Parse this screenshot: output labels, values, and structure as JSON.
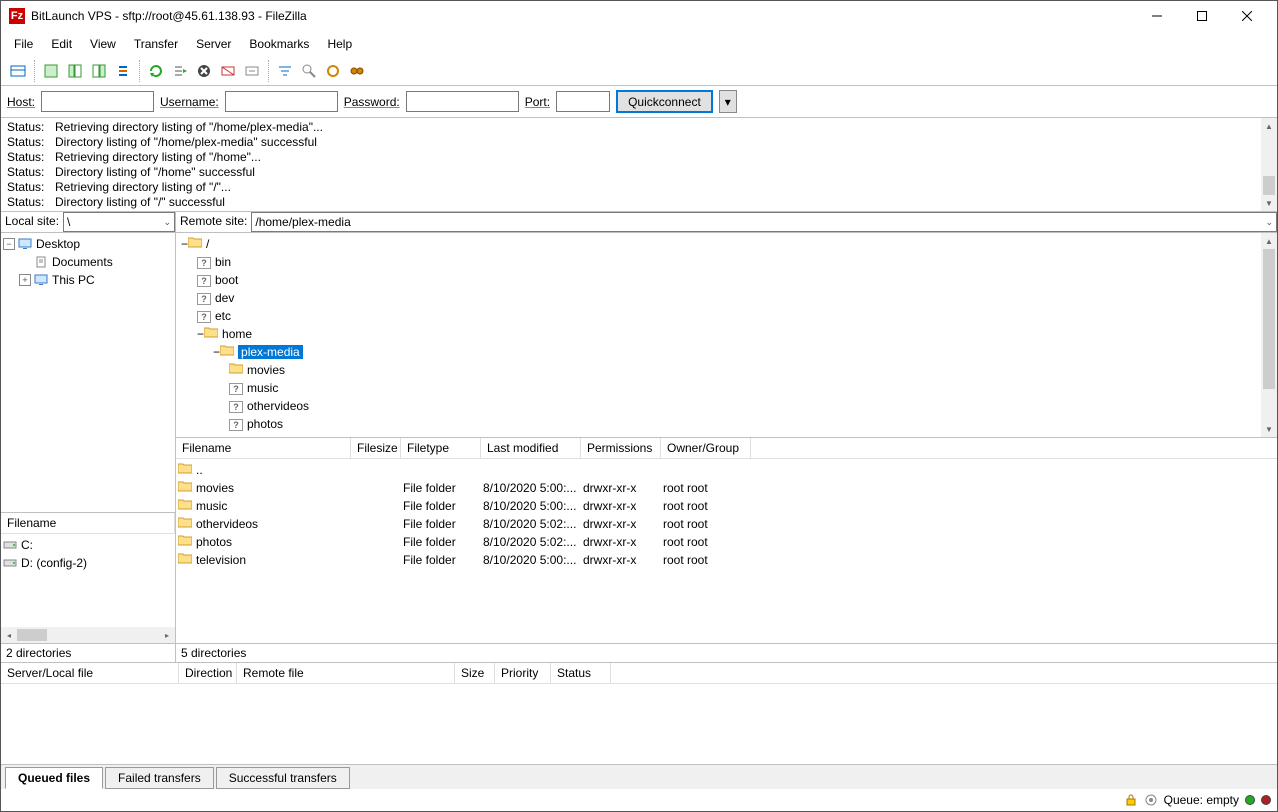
{
  "window": {
    "title": "BitLaunch VPS - sftp://root@45.61.138.93 - FileZilla"
  },
  "menu": [
    "File",
    "Edit",
    "View",
    "Transfer",
    "Server",
    "Bookmarks",
    "Help"
  ],
  "quickconnect": {
    "host_label": "Host:",
    "username_label": "Username:",
    "password_label": "Password:",
    "port_label": "Port:",
    "button": "Quickconnect",
    "host": "",
    "username": "",
    "password": "",
    "port": ""
  },
  "status_log": [
    {
      "label": "Status:",
      "msg": "Retrieving directory listing of \"/home/plex-media\"..."
    },
    {
      "label": "Status:",
      "msg": "Directory listing of \"/home/plex-media\" successful"
    },
    {
      "label": "Status:",
      "msg": "Retrieving directory listing of \"/home\"..."
    },
    {
      "label": "Status:",
      "msg": "Directory listing of \"/home\" successful"
    },
    {
      "label": "Status:",
      "msg": "Retrieving directory listing of \"/\"..."
    },
    {
      "label": "Status:",
      "msg": "Directory listing of \"/\" successful"
    }
  ],
  "local": {
    "site_label": "Local site:",
    "path": "\\",
    "tree": [
      {
        "name": "Desktop",
        "icon": "desktop",
        "exp": "-",
        "level": 0
      },
      {
        "name": "Documents",
        "icon": "doc",
        "exp": "",
        "level": 1
      },
      {
        "name": "This PC",
        "icon": "pc",
        "exp": "+",
        "level": 1
      }
    ],
    "list_header": "Filename",
    "drives": [
      {
        "name": "C:"
      },
      {
        "name": "D: (config-2)"
      }
    ],
    "status": "2 directories"
  },
  "remote": {
    "site_label": "Remote site:",
    "path": "/home/plex-media",
    "tree": [
      {
        "name": "/",
        "icon": "folder",
        "exp": "-",
        "level": 0
      },
      {
        "name": "bin",
        "icon": "q",
        "exp": "",
        "level": 1
      },
      {
        "name": "boot",
        "icon": "q",
        "exp": "",
        "level": 1
      },
      {
        "name": "dev",
        "icon": "q",
        "exp": "",
        "level": 1
      },
      {
        "name": "etc",
        "icon": "q",
        "exp": "",
        "level": 1
      },
      {
        "name": "home",
        "icon": "folder",
        "exp": "-",
        "level": 1
      },
      {
        "name": "plex-media",
        "icon": "folder",
        "exp": "-",
        "level": 2,
        "selected": true
      },
      {
        "name": "movies",
        "icon": "folder",
        "exp": "",
        "level": 3
      },
      {
        "name": "music",
        "icon": "q",
        "exp": "",
        "level": 3
      },
      {
        "name": "othervideos",
        "icon": "q",
        "exp": "",
        "level": 3
      },
      {
        "name": "photos",
        "icon": "q",
        "exp": "",
        "level": 3
      }
    ],
    "columns": [
      "Filename",
      "Filesize",
      "Filetype",
      "Last modified",
      "Permissions",
      "Owner/Group"
    ],
    "files": [
      {
        "name": "..",
        "size": "",
        "type": "",
        "modified": "",
        "perms": "",
        "owner": ""
      },
      {
        "name": "movies",
        "size": "",
        "type": "File folder",
        "modified": "8/10/2020 5:00:...",
        "perms": "drwxr-xr-x",
        "owner": "root root"
      },
      {
        "name": "music",
        "size": "",
        "type": "File folder",
        "modified": "8/10/2020 5:00:...",
        "perms": "drwxr-xr-x",
        "owner": "root root"
      },
      {
        "name": "othervideos",
        "size": "",
        "type": "File folder",
        "modified": "8/10/2020 5:02:...",
        "perms": "drwxr-xr-x",
        "owner": "root root"
      },
      {
        "name": "photos",
        "size": "",
        "type": "File folder",
        "modified": "8/10/2020 5:02:...",
        "perms": "drwxr-xr-x",
        "owner": "root root"
      },
      {
        "name": "television",
        "size": "",
        "type": "File folder",
        "modified": "8/10/2020 5:00:...",
        "perms": "drwxr-xr-x",
        "owner": "root root"
      }
    ],
    "status": "5 directories"
  },
  "queue": {
    "columns": [
      "Server/Local file",
      "Direction",
      "Remote file",
      "Size",
      "Priority",
      "Status"
    ]
  },
  "tabs": [
    "Queued files",
    "Failed transfers",
    "Successful transfers"
  ],
  "bottom_status": {
    "queue": "Queue: empty"
  }
}
